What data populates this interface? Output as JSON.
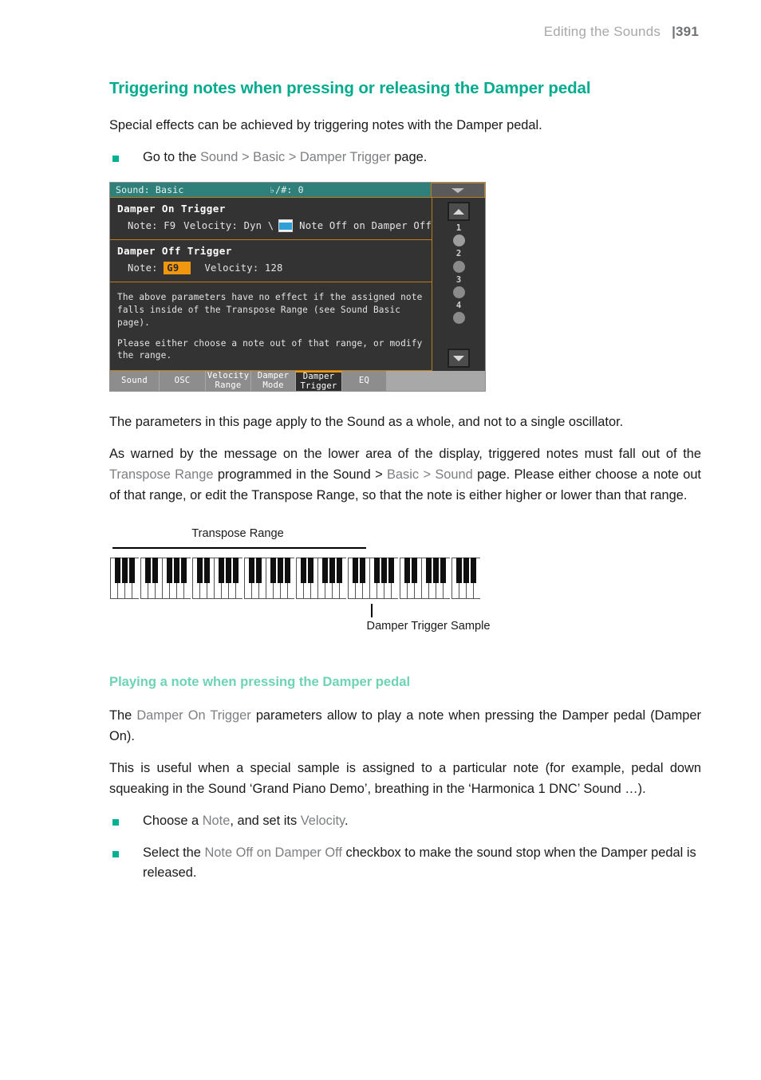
{
  "header": {
    "title": "Editing the Sounds",
    "folio_marker": "|",
    "page_number": "391"
  },
  "section": {
    "title": "Triggering notes when pressing or releasing the Damper pedal",
    "intro": "Special effects can be achieved by triggering notes with the Damper pedal.",
    "bullet_goto": {
      "pre": "Go to the ",
      "path1": "Sound",
      "sep1": " > ",
      "path2": "Basic",
      "sep2": " > ",
      "path3": "Damper Trigger",
      "post": " page."
    },
    "para_scope": "The parameters in this page apply to the Sound as a whole, and not to a single oscillator.",
    "para_warning": {
      "p1": "As warned by the message on the lower area of the display, triggered notes must fall out of the ",
      "ui1": "Transpose Range",
      "p2": " programmed in the Sound > ",
      "ui2": "Basic",
      "p3": " > ",
      "ui3": "Sound",
      "p4": " page. Please either choose a note out of that range, or edit the Transpose Range, so that the note is either higher or lower than that range."
    }
  },
  "device": {
    "titlebar": {
      "page_name": "Sound: Basic",
      "transpose_display": "♭/#: 0",
      "menu_icon": "chevron-down-icon"
    },
    "damper_on": {
      "heading": "Damper On Trigger",
      "note_label": "Note:",
      "note_value": "F9",
      "velocity_label": "Velocity:",
      "velocity_value": "Dyn \\",
      "checkbox_label": "Note Off on Damper Off",
      "checkbox_checked": true
    },
    "damper_off": {
      "heading": "Damper Off Trigger",
      "note_label": "Note:",
      "note_value": "G9",
      "note_selected": true,
      "velocity_label": "Velocity:",
      "velocity_value": "128"
    },
    "message": {
      "line1": "The above parameters have no effect if the assigned note falls inside of the Transpose Range (see Sound Basic page).",
      "line2": "Please either choose a note out of that range, or modify the range."
    },
    "side_panel": {
      "up_icon": "triangle-up-icon",
      "down_icon": "triangle-down-icon",
      "slots": [
        "1",
        "2",
        "3",
        "4"
      ]
    },
    "tabs": [
      {
        "line1": "Sound",
        "line2": "",
        "active": false
      },
      {
        "line1": "OSC",
        "line2": "",
        "active": false
      },
      {
        "line1": "Velocity",
        "line2": "Range",
        "active": false
      },
      {
        "line1": "Damper",
        "line2": "Mode",
        "active": false
      },
      {
        "line1": "Damper",
        "line2": "Trigger",
        "active": true
      },
      {
        "line1": "EQ",
        "line2": "",
        "active": false
      }
    ]
  },
  "keyboard_figure": {
    "top_label": "Transpose Range",
    "bottom_label": "Damper Trigger Sample"
  },
  "subsection": {
    "title": "Playing a note when pressing the Damper pedal",
    "para_intro": {
      "p1": "The ",
      "ui1": "Damper On Trigger",
      "p2": " parameters allow to play a note when pressing the Damper pedal (Damper On)."
    },
    "para_useful": "This is useful when a special sample is assigned to a particular note (for example, pedal down squeaking in the Sound ‘Grand Piano Demo’, breathing in the ‘Harmonica 1 DNC’ Sound …).",
    "bullet_choose": {
      "p1": "Choose a ",
      "ui1": "Note",
      "p2": ", and set its ",
      "ui2": "Velocity",
      "p3": "."
    },
    "bullet_select": {
      "p1": "Select the ",
      "ui1": "Note Off on Damper Off",
      "p2": " checkbox to make the sound stop when the Damper pedal is released."
    }
  },
  "colors": {
    "accent_title": "#00ab8e",
    "accent_subtitle": "#6ed3b4",
    "bullet": "#00b092",
    "device_titlebar": "#2f807b",
    "device_highlight": "#f0960f",
    "checkbox_fill": "#2f9fd8"
  }
}
